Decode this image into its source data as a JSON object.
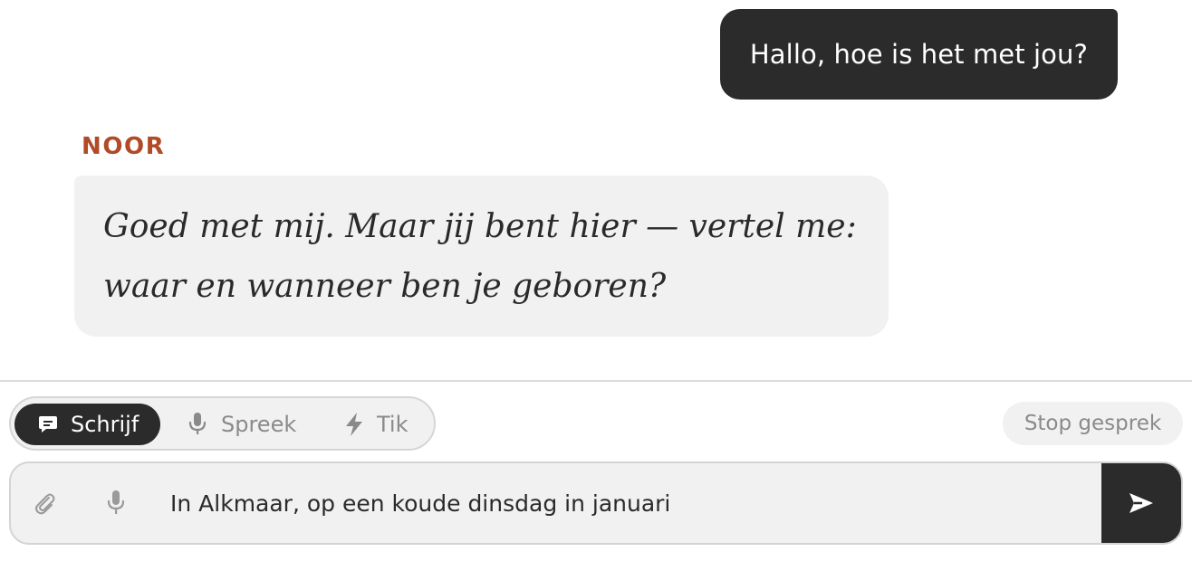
{
  "conversation": {
    "user_message": "Hallo, hoe is het met jou?",
    "assistant_name": "NOOR",
    "assistant_message": "Goed met mij. Maar jij bent hier — vertel me: waar en wanneer ben je geboren?"
  },
  "mode_switch": {
    "selected": "Schrijf",
    "options": [
      {
        "label": "Schrijf",
        "icon": "chat-bubble-icon"
      },
      {
        "label": "Spreek",
        "icon": "microphone-icon"
      },
      {
        "label": "Tik",
        "icon": "lightning-icon"
      }
    ]
  },
  "stop_button": {
    "label": "Stop gesprek"
  },
  "composer": {
    "value": "In Alkmaar, op een koude dinsdag in januari",
    "icons": [
      "paperclip-icon",
      "microphone-icon",
      "send-icon"
    ]
  },
  "colors": {
    "accent_name": "#b14a26",
    "dark_bubble": "#2b2b2b",
    "light_bubble": "#f1f1f1"
  }
}
